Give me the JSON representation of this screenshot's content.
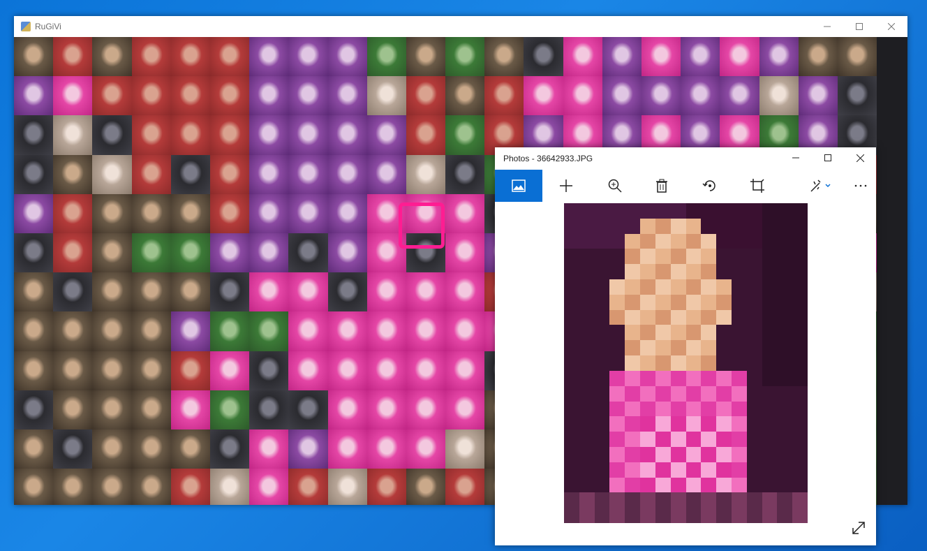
{
  "main_window": {
    "title": "RuGiVi",
    "controls": [
      "minimize",
      "maximize",
      "close"
    ]
  },
  "photos_window": {
    "title": "Photos - 36642933.JPG",
    "toolbar": [
      {
        "name": "view-icon",
        "active": true
      },
      {
        "name": "add-icon"
      },
      {
        "name": "zoom-icon"
      },
      {
        "name": "delete-icon"
      },
      {
        "name": "rotate-icon"
      },
      {
        "name": "crop-icon"
      },
      {
        "name": "edit-icon"
      },
      {
        "name": "more-icon"
      }
    ]
  },
  "colors": {
    "highlight": "#ff1d92",
    "accent": "#0a6fd4"
  }
}
